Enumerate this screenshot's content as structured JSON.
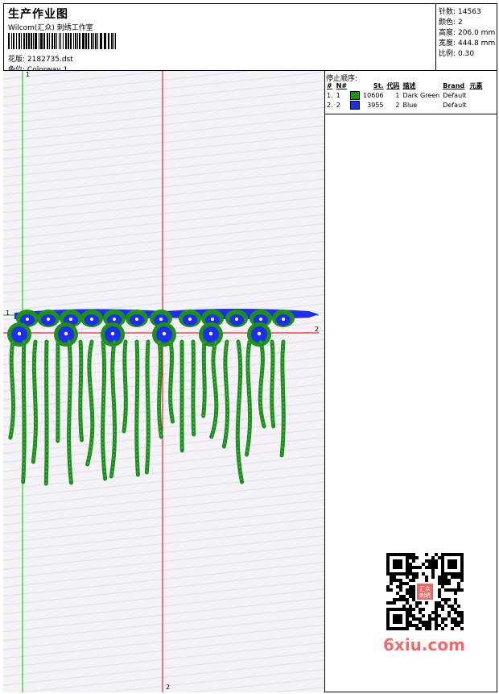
{
  "header": {
    "title": "生产作业图",
    "studio": "Wilcom(汇众) 刺绣工作室",
    "design_label": "花版:",
    "design_value": "2182735.dst",
    "colorway_label": "色位:",
    "colorway_value": "Colorway 1"
  },
  "stats": [
    {
      "label": "针数:",
      "value": "14563"
    },
    {
      "label": "颜色:",
      "value": "2"
    },
    {
      "label": "高度:",
      "value": "206.0 mm"
    },
    {
      "label": "宽度:",
      "value": "444.8 mm"
    },
    {
      "label": "比例:",
      "value": "0.30"
    }
  ],
  "stop_sequence": {
    "title": "停止顺序:",
    "headers": [
      "#",
      "N#",
      "St.",
      "代码",
      "描述",
      "Brand",
      "元素"
    ],
    "rows": [
      {
        "idx": "1.",
        "n": "1",
        "color": "#1f8f1f",
        "stitches": "10606",
        "code": "1",
        "desc": "Dark Green",
        "brand": "Default",
        "element": ""
      },
      {
        "idx": "2.",
        "n": "2",
        "color": "#1f2fe6",
        "stitches": "3955",
        "code": "2",
        "desc": "Blue",
        "brand": "Default",
        "element": ""
      }
    ]
  },
  "canvas_markers": {
    "v1": "1",
    "v2_bottom": "2",
    "h1": "1",
    "h2": "2"
  },
  "watermark": {
    "qr_center": "汇众刺绣",
    "site": "6xiu.com"
  },
  "colors": {
    "green": "#1f8f1f",
    "blue": "#1f2fe6",
    "guide_green": "#00c000",
    "guide_red": "#e00000"
  }
}
